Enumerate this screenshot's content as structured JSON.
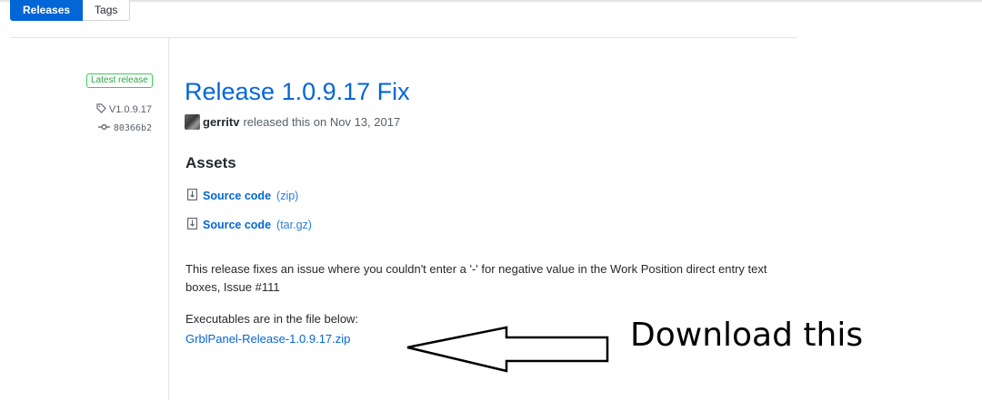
{
  "tabs": {
    "releases": "Releases",
    "tags": "Tags"
  },
  "sidebar": {
    "badge": "Latest release",
    "tag": "V1.0.9.17",
    "commit": "80366b2"
  },
  "release": {
    "title": "Release 1.0.9.17 Fix",
    "author": "gerritv",
    "meta_text": "released this on Nov 13, 2017"
  },
  "assets": {
    "heading": "Assets",
    "items": [
      {
        "label": "Source code",
        "ext": "(zip)"
      },
      {
        "label": "Source code",
        "ext": "(tar.gz)"
      }
    ]
  },
  "notes": {
    "paragraph": "This release fixes an issue where you couldn't enter a '-' for negative value in the Work Position direct entry text boxes, Issue #111",
    "executables_text": "Executables are in the file below:",
    "executable_link": "GrblPanel-Release-1.0.9.17.zip"
  },
  "annotation": {
    "text": "Download this"
  },
  "colors": {
    "accent": "#0366d6",
    "badge_green": "#28a745"
  }
}
